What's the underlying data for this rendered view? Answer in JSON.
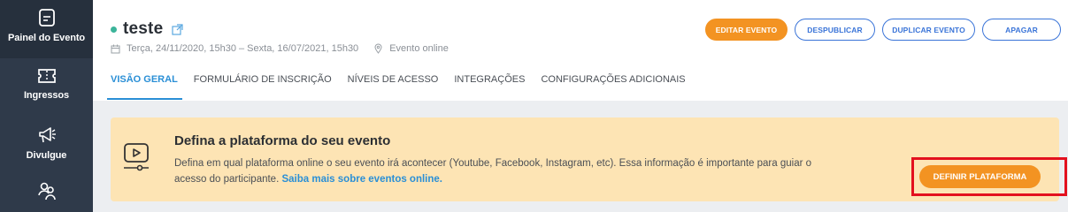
{
  "sidebar": {
    "items": [
      {
        "label": "Painel do Evento",
        "icon": "dashboard-icon"
      },
      {
        "label": "Ingressos",
        "icon": "ticket-icon"
      },
      {
        "label": "Divulgue",
        "icon": "megaphone-icon"
      },
      {
        "label": "",
        "icon": "participants-icon"
      }
    ]
  },
  "event": {
    "title": "teste",
    "status_color": "#3cb49a",
    "dates": "Terça, 24/11/2020, 15h30 – Sexta, 16/07/2021, 15h30",
    "location": "Evento online"
  },
  "header_buttons": {
    "edit": "EDITAR EVENTO",
    "unpublish": "DESPUBLICAR",
    "duplicate": "DUPLICAR EVENTO",
    "delete": "APAGAR"
  },
  "tabs": [
    {
      "label": "VISÃO GERAL",
      "active": true
    },
    {
      "label": "FORMULÁRIO DE INSCRIÇÃO",
      "active": false
    },
    {
      "label": "NÍVEIS DE ACESSO",
      "active": false
    },
    {
      "label": "INTEGRAÇÕES",
      "active": false
    },
    {
      "label": "CONFIGURAÇÕES ADICIONAIS",
      "active": false
    }
  ],
  "banner": {
    "title": "Defina a plataforma do seu evento",
    "text": "Defina em qual plataforma online o seu evento irá acontecer (Youtube, Facebook, Instagram, etc). Essa informação é importante para guiar o acesso do participante.",
    "link": "Saiba mais sobre eventos online.",
    "button": "DEFINIR PLATAFORMA"
  },
  "colors": {
    "accent": "#f39322",
    "link": "#2a8fd6",
    "sidebar": "#2f3a4a",
    "highlight": "#e3101e"
  }
}
